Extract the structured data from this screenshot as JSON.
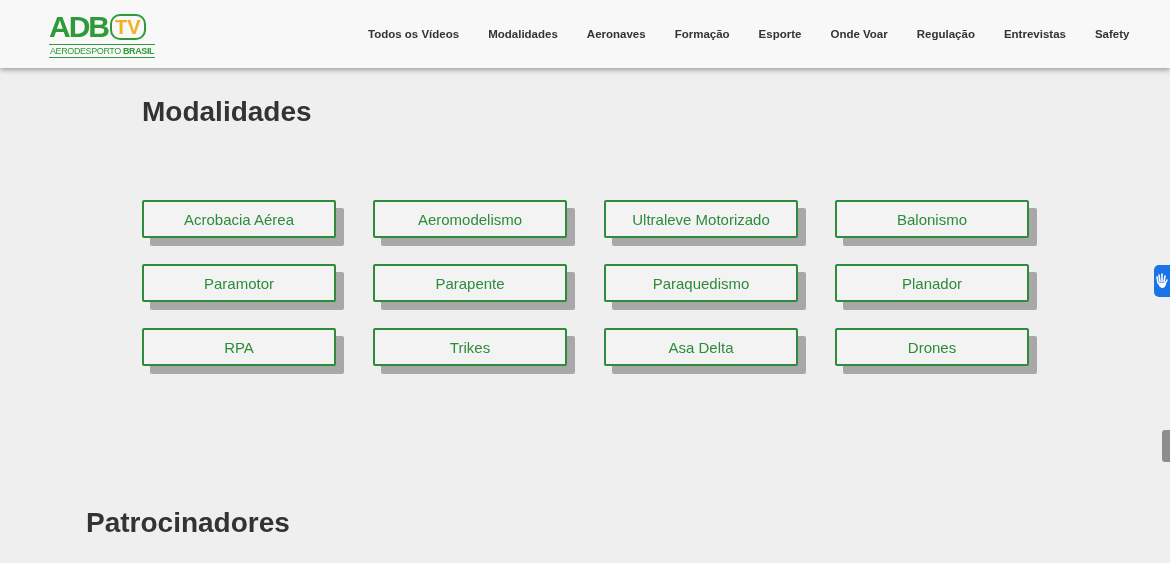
{
  "logo": {
    "mark": "ADB",
    "badge": "TV",
    "name": "AERODESPORTO **BRASIL**"
  },
  "nav": [
    "Todos os Vídeos",
    "Modalidades",
    "Aeronaves",
    "Formação",
    "Esporte",
    "Onde Voar",
    "Regulação",
    "Entrevistas",
    "Safety"
  ],
  "section_title": "Modalidades",
  "modalities": [
    "Acrobacia Aérea",
    "Aeromodelismo",
    "Ultraleve Motorizado",
    "Balonismo",
    "Paramotor",
    "Parapente",
    "Paraquedismo",
    "Planador",
    "RPA",
    "Trikes",
    "Asa Delta",
    "Drones"
  ],
  "sponsors_title": "Patrocinadores"
}
